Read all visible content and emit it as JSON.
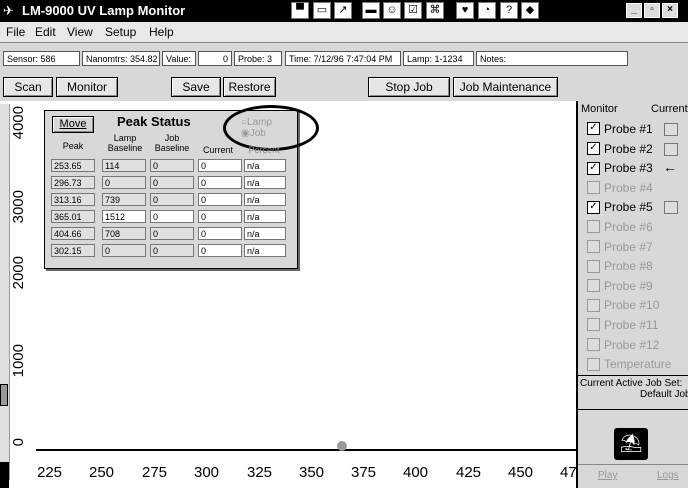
{
  "window": {
    "title": "LM-9000 UV Lamp Monitor",
    "app_icon": "aircraft-icon",
    "toolbar_icons": [
      "monitor-icon",
      "window-icon",
      "chart-icon",
      "display-icon",
      "person-icon",
      "checkbox-icon",
      "shortcut-icon",
      "heart-icon",
      "pie-icon",
      "help-icon",
      "gem-icon"
    ],
    "controls": {
      "minimize": "_",
      "maximize": "▫",
      "close": "×"
    }
  },
  "menu": [
    "File",
    "Edit",
    "View",
    "Setup",
    "Help"
  ],
  "status": {
    "sensor": "Sensor: 586",
    "nanometers": "Nanomtrs: 354.82",
    "value_label": "Value:",
    "value": "0",
    "probe": "Probe: 3",
    "time": "Time: 7/12/96 7:47:04 PM",
    "lamp": "Lamp: 1-1234",
    "notes": "Notes:"
  },
  "toolbar": {
    "scan": "Scan",
    "monitor": "Monitor",
    "save": "Save",
    "restore": "Restore",
    "stop_job": "Stop Job",
    "job_maintenance": "Job Maintenance"
  },
  "plot": {
    "y_ticks": [
      "4000",
      "3000",
      "2000",
      "1000",
      "0"
    ],
    "x_ticks": [
      "225",
      "250",
      "275",
      "300",
      "325",
      "350",
      "375",
      "400",
      "425",
      "450",
      "47"
    ]
  },
  "peak_status": {
    "move": "Move",
    "title": "Peak Status",
    "radio_lamp": "Lamp",
    "radio_job": "Job",
    "headers": [
      "Peak",
      "Lamp\nBaseline",
      "Job\nBaseline",
      "Current",
      "Percent"
    ],
    "rows": [
      [
        "253.65",
        "114",
        "0",
        "0",
        "n/a"
      ],
      [
        "296.73",
        "0",
        "0",
        "0",
        "n/a"
      ],
      [
        "313.16",
        "739",
        "0",
        "0",
        "n/a"
      ],
      [
        "365.01",
        "1512",
        "0",
        "0",
        "n/a"
      ],
      [
        "404.66",
        "708",
        "0",
        "0",
        "n/a"
      ],
      [
        "302.15",
        "0",
        "0",
        "0",
        "n/a"
      ]
    ]
  },
  "panel": {
    "monitor_header": "Monitor",
    "current_header": "Current",
    "probes": [
      {
        "label": "Probe #1",
        "checked": true,
        "enabled": true
      },
      {
        "label": "Probe #2",
        "checked": true,
        "enabled": true
      },
      {
        "label": "Probe #3",
        "checked": true,
        "enabled": true
      },
      {
        "label": "Probe #4",
        "checked": false,
        "enabled": false
      },
      {
        "label": "Probe #5",
        "checked": true,
        "enabled": true
      },
      {
        "label": "Probe #6",
        "checked": false,
        "enabled": false
      },
      {
        "label": "Probe #7",
        "checked": false,
        "enabled": false
      },
      {
        "label": "Probe #8",
        "checked": false,
        "enabled": false
      },
      {
        "label": "Probe #9",
        "checked": false,
        "enabled": false
      },
      {
        "label": "Probe #10",
        "checked": false,
        "enabled": false
      },
      {
        "label": "Probe #11",
        "checked": false,
        "enabled": false
      },
      {
        "label": "Probe #12",
        "checked": false,
        "enabled": false
      },
      {
        "label": "Temperature",
        "checked": false,
        "enabled": false
      }
    ],
    "job_set_label": "Current Active Job Set:",
    "job_set_value": "Default Job",
    "play": "Play",
    "logs": "Logs",
    "logo_icon": "parachute-logo-icon"
  }
}
